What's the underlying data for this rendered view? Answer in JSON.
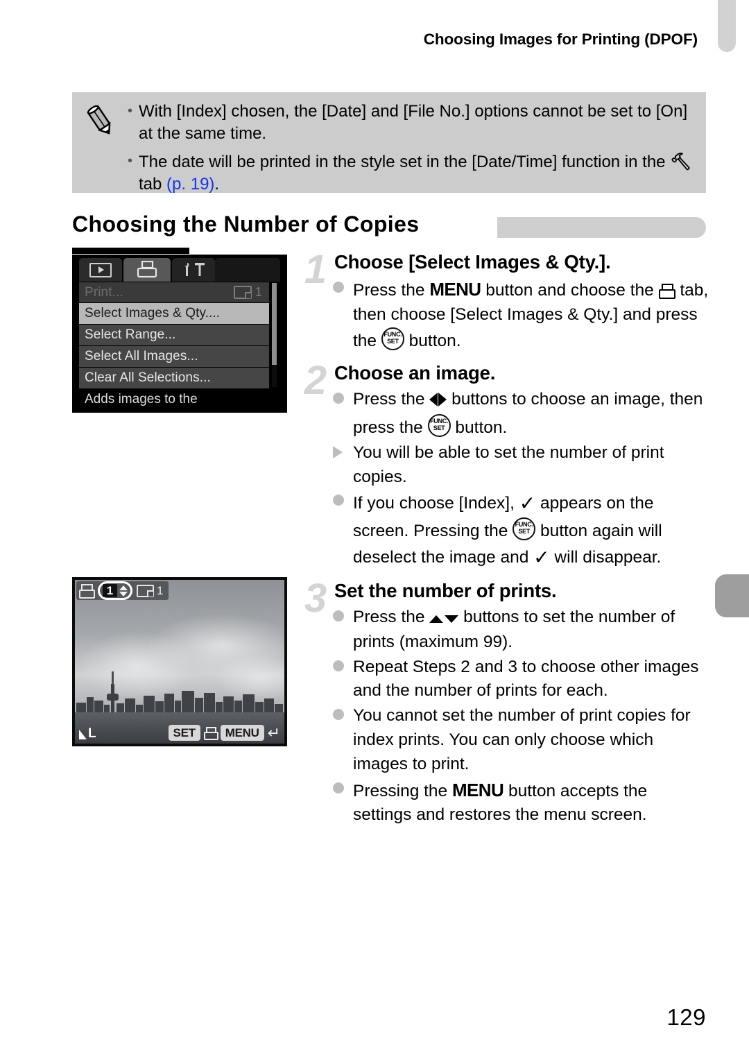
{
  "running_head": "Choosing Images for Printing (DPOF)",
  "folio": "129",
  "note_box": {
    "icon": "pencil-icon",
    "items": [
      {
        "text": "With [Index] chosen, the [Date] and [File No.] options cannot be set to [On] at the same time."
      },
      {
        "text_before": "The date will be printed in the style set in the [Date/Time] function in the",
        "glyph": "YT",
        "text_mid": "tab",
        "page_ref": "(p. 19)",
        "text_after": "."
      }
    ]
  },
  "section": {
    "title": "Choosing the Number of Copies"
  },
  "menu_screenshot": {
    "tabs": [
      {
        "name": "playback-tab",
        "icon": "play-icon",
        "selected": false
      },
      {
        "name": "print-tab",
        "icon": "printer-icon",
        "selected": true
      },
      {
        "name": "settings-tab",
        "icon": "wrench-hammer-icon",
        "selected": false
      }
    ],
    "rows": [
      {
        "label": "Print...",
        "value": "1",
        "state": "disabled"
      },
      {
        "label": "Select Images & Qty....",
        "value": "",
        "state": "selected"
      },
      {
        "label": "Select Range...",
        "value": "",
        "state": "normal"
      },
      {
        "label": "Select All Images...",
        "value": "",
        "state": "normal"
      },
      {
        "label": "Clear All Selections...",
        "value": "",
        "state": "normal"
      }
    ],
    "hint": "Adds images to the"
  },
  "photo_screenshot": {
    "print_qty": "1",
    "frame_count": "1",
    "quality_label": "L",
    "set_key": "SET",
    "menu_key": "MENU"
  },
  "steps": [
    {
      "num": "1",
      "title": "Choose [Select Images & Qty.].",
      "bullets": [
        {
          "marker": "dot",
          "parts": [
            {
              "t": "text",
              "v": "Press the "
            },
            {
              "t": "menu",
              "v": "MENU"
            },
            {
              "t": "text",
              "v": " button and choose the "
            },
            {
              "t": "printer",
              "v": ""
            },
            {
              "t": "text",
              "v": " tab, then choose [Select Images & Qty.] and press the "
            },
            {
              "t": "func",
              "v": "FUNC. SET"
            },
            {
              "t": "text",
              "v": " button."
            }
          ]
        }
      ]
    },
    {
      "num": "2",
      "title": "Choose an image.",
      "bullets": [
        {
          "marker": "dot",
          "parts": [
            {
              "t": "text",
              "v": "Press the "
            },
            {
              "t": "leftright",
              "v": ""
            },
            {
              "t": "text",
              "v": " buttons to choose an image, then press the "
            },
            {
              "t": "func",
              "v": "FUNC. SET"
            },
            {
              "t": "text",
              "v": " button."
            }
          ]
        },
        {
          "marker": "arrow",
          "parts": [
            {
              "t": "text",
              "v": "You will be able to set the number of print copies."
            }
          ]
        },
        {
          "marker": "dot",
          "parts": [
            {
              "t": "text",
              "v": "If you choose [Index], "
            },
            {
              "t": "check",
              "v": "✓"
            },
            {
              "t": "text",
              "v": " appears on the screen. Pressing the "
            },
            {
              "t": "func",
              "v": "FUNC. SET"
            },
            {
              "t": "text",
              "v": " button again will deselect the image and "
            },
            {
              "t": "check",
              "v": "✓"
            },
            {
              "t": "text",
              "v": " will disappear."
            }
          ]
        }
      ]
    },
    {
      "num": "3",
      "title": "Set the number of prints.",
      "bullets": [
        {
          "marker": "dot",
          "parts": [
            {
              "t": "text",
              "v": "Press the "
            },
            {
              "t": "updown",
              "v": ""
            },
            {
              "t": "text",
              "v": " buttons to set the number of prints (maximum 99)."
            }
          ]
        },
        {
          "marker": "dot",
          "parts": [
            {
              "t": "text",
              "v": "Repeat Steps 2 and 3 to choose other images and the number of prints for each."
            }
          ]
        },
        {
          "marker": "dot",
          "parts": [
            {
              "t": "text",
              "v": "You cannot set the number of print copies for index prints. You can only choose which images to print."
            }
          ]
        },
        {
          "marker": "dot",
          "parts": [
            {
              "t": "text",
              "v": "Pressing the "
            },
            {
              "t": "menu",
              "v": "MENU"
            },
            {
              "t": "text",
              "v": " button accepts the settings and restores the menu screen."
            }
          ]
        }
      ]
    }
  ],
  "colors": {
    "note_bg": "#cccccc",
    "link": "#1335e8",
    "step_num": "#d4d4d4",
    "bullet": "#bdbdbd",
    "heading_bar": "#cfcfcf",
    "edge_tab_top": "#d2d2d2",
    "edge_tab_side": "#9e9e9e"
  }
}
